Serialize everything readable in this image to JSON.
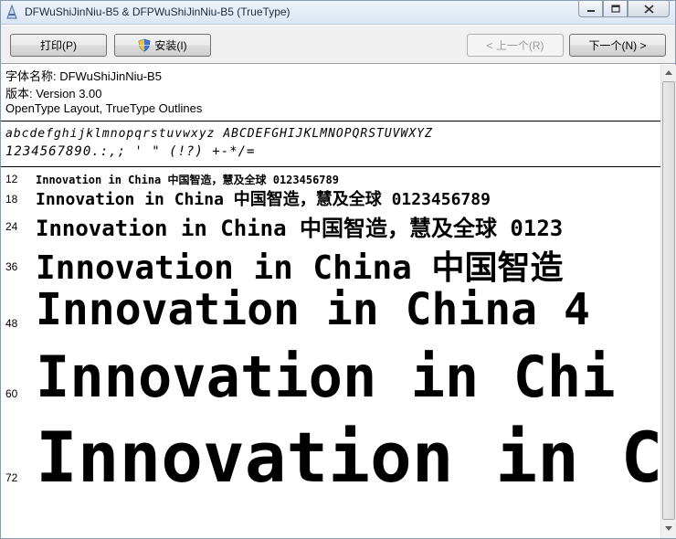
{
  "window": {
    "title": "DFWuShiJinNiu-B5 & DFPWuShiJinNiu-B5  (TrueType)",
    "app_icon": "font-file-icon",
    "caption_buttons": {
      "minimize": "minimize-icon",
      "maximize": "maximize-icon",
      "close": "close-icon"
    }
  },
  "toolbar": {
    "print_label": "打印(P)",
    "install_label": "安装(I)",
    "prev_label": "< 上一个(R)",
    "next_label": "下一个(N) >"
  },
  "font_info": {
    "name_line": "字体名称: DFWuShiJinNiu-B5",
    "version_line": "版本: Version 3.00",
    "type_line": "OpenType Layout, TrueType Outlines"
  },
  "charset": {
    "line1": "abcdefghijklmnopqrstuvwxyz ABCDEFGHIJKLMNOPQRSTUVWXYZ",
    "line2": "1234567890.:,; ' \" (!?) +-*/="
  },
  "samples": [
    {
      "size": "12",
      "text": "Innovation in China 中国智造，慧及全球 0123456789"
    },
    {
      "size": "18",
      "text": "Innovation in China 中国智造，慧及全球 0123456789"
    },
    {
      "size": "24",
      "text": "Innovation in China 中国智造，慧及全球 0123"
    },
    {
      "size": "36",
      "text": "Innovation in China 中国智造"
    },
    {
      "size": "48",
      "text": "Innovation in China 4"
    },
    {
      "size": "60",
      "text": "Innovation in Chi"
    },
    {
      "size": "72",
      "text": "Innovation in C"
    }
  ]
}
